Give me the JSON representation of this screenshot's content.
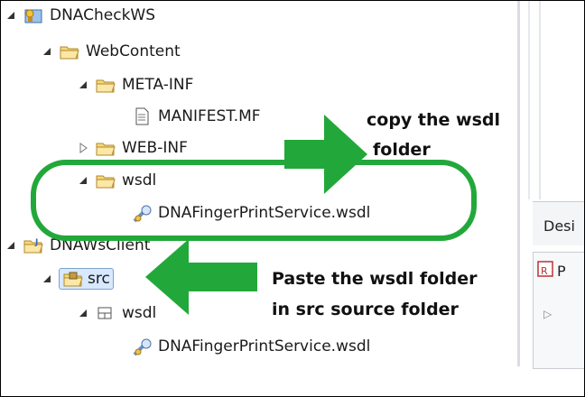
{
  "tree": {
    "items": [
      {
        "label": "DNACheckWS",
        "icon": "web-project-icon",
        "expanded": true
      },
      {
        "label": "WebContent",
        "icon": "folder-icon",
        "expanded": true
      },
      {
        "label": "META-INF",
        "icon": "folder-icon",
        "expanded": true
      },
      {
        "label": "MANIFEST.MF",
        "icon": "file-icon"
      },
      {
        "label": "WEB-INF",
        "icon": "folder-icon",
        "expanded": false
      },
      {
        "label": "wsdl",
        "icon": "folder-icon",
        "expanded": true
      },
      {
        "label": "DNAFingerPrintService.wsdl",
        "icon": "wsdl-file-icon"
      },
      {
        "label": "DNAWsClient",
        "icon": "java-project-icon",
        "expanded": true
      },
      {
        "label": "src",
        "icon": "source-folder-icon",
        "expanded": true,
        "selected": true
      },
      {
        "label": "wsdl",
        "icon": "package-icon",
        "expanded": true
      },
      {
        "label": "DNAFingerPrintService.wsdl",
        "icon": "wsdl-file-icon"
      }
    ]
  },
  "annotations": {
    "copy_line1": "copy the wsdl",
    "copy_line2": "folder",
    "paste_line1": "Paste the wsdl folder",
    "paste_line2": "in src source folder",
    "accent_color": "#22a83a"
  },
  "right_panel": {
    "tab_label": "Desi",
    "view_label": "P"
  }
}
